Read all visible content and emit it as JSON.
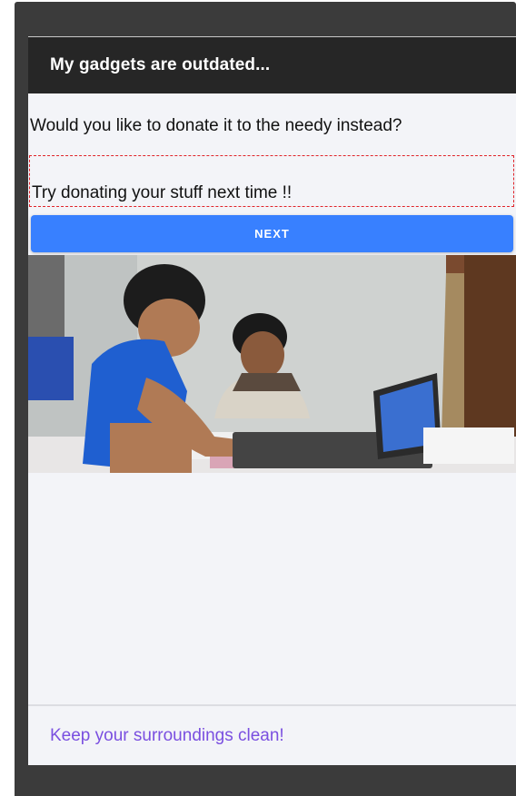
{
  "header": {
    "title": "My gadgets are outdated..."
  },
  "main": {
    "question": "Would you like to donate it to the needy instead?",
    "message": "Try donating your stuff next time !!",
    "next_button_label": "NEXT"
  },
  "footer": {
    "text": "Keep your surroundings clean!"
  },
  "colors": {
    "frame": "#3b3b3b",
    "header_bg": "#262626",
    "screen_bg": "#f3f4f8",
    "button_bg": "#3880ff",
    "dashed_border": "#e0242a",
    "footer_text": "#7a4fe0"
  }
}
